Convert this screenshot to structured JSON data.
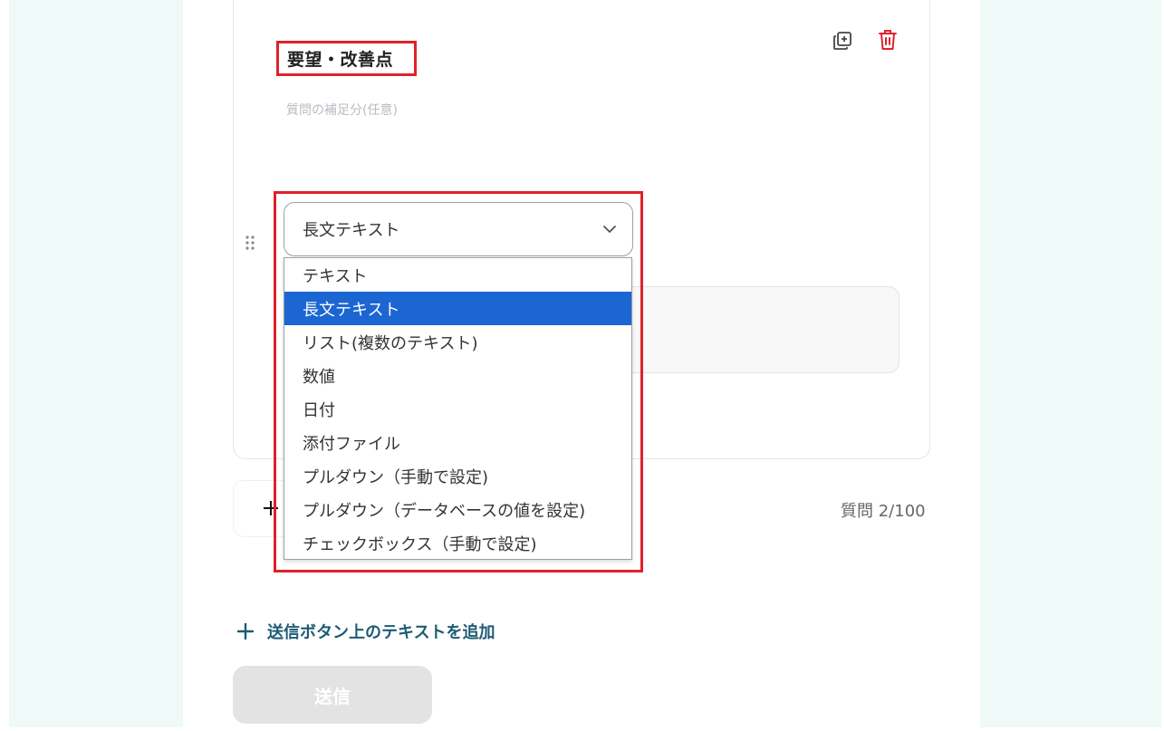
{
  "question": {
    "title": "要望・改善点",
    "supplement_placeholder": "質問の補足分(任意)"
  },
  "answer_type": {
    "selected": "長文テキスト",
    "options": [
      {
        "label": "テキスト",
        "selected": false
      },
      {
        "label": "長文テキスト",
        "selected": true
      },
      {
        "label": "リスト(複数のテキスト)",
        "selected": false
      },
      {
        "label": "数値",
        "selected": false
      },
      {
        "label": "日付",
        "selected": false
      },
      {
        "label": "添付ファイル",
        "selected": false
      },
      {
        "label": "プルダウン（手動で設定)",
        "selected": false
      },
      {
        "label": "プルダウン（データベースの値を設定)",
        "selected": false
      },
      {
        "label": "チェックボックス（手動で設定)",
        "selected": false
      }
    ]
  },
  "footer": {
    "question_count": "質問 2/100",
    "add_text_label": "送信ボタン上のテキストを追加",
    "submit_label": "送信"
  },
  "colors": {
    "highlight": "#e0212b",
    "selected_option": "#1b66d2",
    "link": "#1d5b74",
    "background_mint": "#eff9f7"
  },
  "icons": [
    "copy-icon",
    "trash-icon",
    "drag-handle-icon",
    "chevron-down-icon",
    "plus-icon"
  ]
}
